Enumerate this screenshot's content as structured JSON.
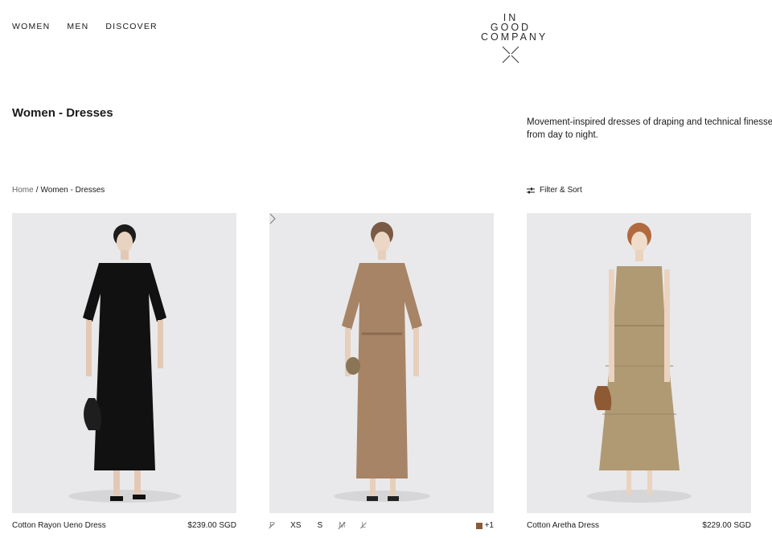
{
  "nav": {
    "items": [
      {
        "label": "WOMEN"
      },
      {
        "label": "MEN"
      },
      {
        "label": "DISCOVER"
      }
    ]
  },
  "logo": {
    "line1": "IN GOOD",
    "line2": "COMPANY"
  },
  "page": {
    "title": "Women - Dresses",
    "intro_line1": "Movement-inspired dresses of draping and technical finesse: com",
    "intro_line2": "from day to night."
  },
  "breadcrumb": {
    "home": "Home",
    "separator": "/",
    "current": "Women - Dresses"
  },
  "filter": {
    "label": "Filter & Sort",
    "icon": "sliders-icon"
  },
  "products": [
    {
      "name": "Cotton Rayon Ueno Dress",
      "price": "$239.00 SGD",
      "dress_color": "#111111"
    },
    {
      "dress_color": "#a78466",
      "sizes": [
        {
          "label": "F",
          "available": false
        },
        {
          "label": "XS",
          "available": true
        },
        {
          "label": "S",
          "available": true
        },
        {
          "label": "M",
          "available": false
        },
        {
          "label": "L",
          "available": false
        }
      ],
      "swatch_color": "#8a5a3a",
      "more_colors": "+1"
    },
    {
      "name": "Cotton Aretha Dress",
      "price": "$229.00 SGD",
      "dress_color": "#b09a74"
    }
  ],
  "colors": {
    "image_bg": "#e9e9eb",
    "text": "#1a1a1a"
  }
}
